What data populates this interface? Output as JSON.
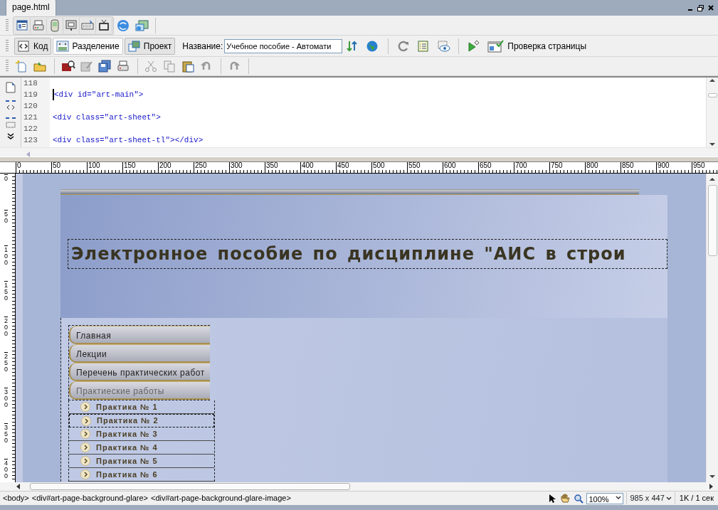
{
  "document_tab": {
    "label": "page.html"
  },
  "view_buttons": [
    {
      "label": "Код",
      "selected": false
    },
    {
      "label": "Разделение",
      "selected": true
    },
    {
      "label": "Проект",
      "selected": false
    }
  ],
  "title_field": {
    "label": "Название:",
    "value": "Учебное пособие - Автомати"
  },
  "check_page_button": {
    "label": "Проверка страницы"
  },
  "code_lines": [
    {
      "number": "118"
    },
    {
      "number": "119",
      "text": "<div id=\"art-main\">"
    },
    {
      "number": "120"
    },
    {
      "number": "121",
      "text": "<div class=\"art-sheet\">"
    },
    {
      "number": "122"
    },
    {
      "number": "123",
      "text": "<div class=\"art-sheet-tl\"></div>"
    }
  ],
  "ruler": {
    "horizontal_ticks": [
      "0",
      "50",
      "100",
      "150",
      "200",
      "250",
      "300",
      "350",
      "400",
      "450",
      "500",
      "550",
      "600",
      "650",
      "700",
      "750",
      "800",
      "850",
      "900",
      "950"
    ],
    "vertical_ticks": [
      "0",
      "50",
      "100",
      "150",
      "200",
      "250",
      "300",
      "350",
      "400"
    ]
  },
  "design": {
    "heading": "Электронное пособие по дисциплине \"АИС в строи",
    "menu": [
      {
        "label": "Главная",
        "selected": false
      },
      {
        "label": "Лекции",
        "selected": false
      },
      {
        "label": "Перечень практических работ",
        "selected": false
      },
      {
        "label": "Практиеские работы",
        "selected": true
      }
    ],
    "submenu": [
      {
        "label": "Практика № 1",
        "selected": false
      },
      {
        "label": "Практика № 2",
        "selected": true
      },
      {
        "label": "Практика № 3",
        "selected": false
      },
      {
        "label": "Практика № 4",
        "selected": false
      },
      {
        "label": "Практика № 5",
        "selected": false
      },
      {
        "label": "Практика № 6",
        "selected": false
      }
    ]
  },
  "status_bar": {
    "tag_path": [
      "<body>",
      "<div#art-page-background-glare>",
      "<div#art-page-background-glare-image>"
    ],
    "zoom": "100%",
    "dimensions": "985 x 447",
    "download": "1K / 1 сек"
  }
}
